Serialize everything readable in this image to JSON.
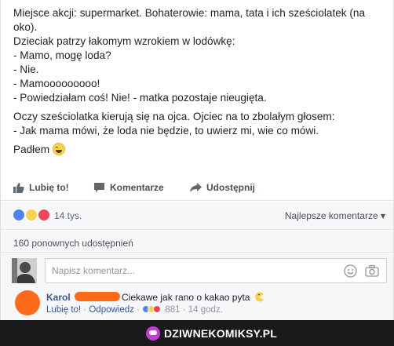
{
  "post": {
    "lines": [
      "Miejsce akcji: supermarket. Bohaterowie: mama, tata i ich sześciolatek (na oko).",
      "Dzieciak patrzy łakomym wzrokiem w lodówkę:",
      "- Mamo, mogę loda?",
      "- Nie.",
      "- Mamooooooooo!",
      "- Powiedziałam coś! Nie! - matka pozostaje nieugięta.",
      "Oczy sześciolatka kierują się na ojca. Ojciec na to zbolałym głosem:",
      "- Jak mama mówi, że loda nie będzie, to uwierz mi, wie co mówi.",
      "Padłem"
    ],
    "end_emoji": "laughing-emoji"
  },
  "actions": {
    "like": "Lubię to!",
    "comment": "Komentarze",
    "share": "Udostępnij"
  },
  "reactions": {
    "count": "14 tys.",
    "sort_label": "Najlepsze komentarze",
    "sort_arrow": "▾"
  },
  "shares": "160 ponownych udostępnień",
  "composer": {
    "placeholder": "Napisz komentarz..."
  },
  "comment": {
    "name": "Karol",
    "text": "Ciekawe jak rano o kakao pyta",
    "like": "Lubię to!",
    "sep1": " · ",
    "reply": "Odpowiedz",
    "sep2": " · ",
    "reaction_count": "881",
    "sep3": " · ",
    "time": "14 godz."
  },
  "footer": {
    "brand": "DZIWNEKOMIKSY.PL"
  },
  "colors": {
    "link": "#365899",
    "like": "#4f83f0",
    "haha": "#f7d14c",
    "love": "#f0435a",
    "brand": "#c63ad6"
  }
}
